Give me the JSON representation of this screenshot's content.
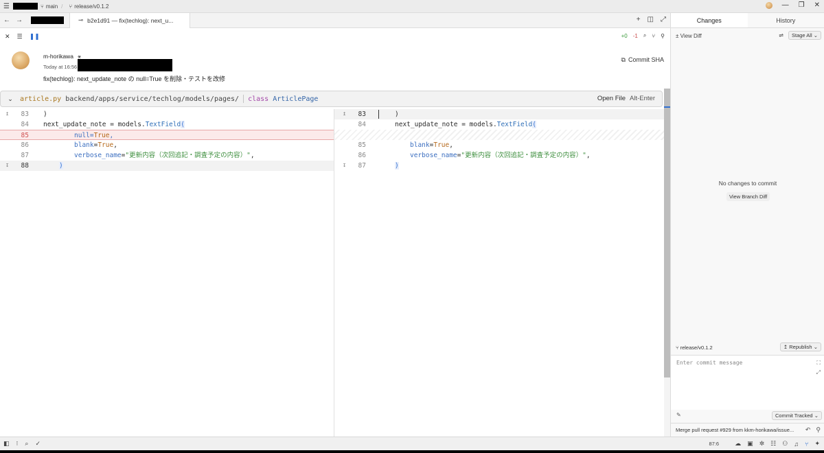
{
  "titlebar": {
    "menu_icon": "hamburger-icon",
    "branch_main": "main",
    "branch_release": "release/v0.1.2",
    "window_controls": [
      "minimize",
      "maximize",
      "close"
    ]
  },
  "tabs": {
    "active_title": "b2e1d91 — fix(techlog): next_u..."
  },
  "toolbar": {
    "additions": "+0",
    "deletions": "-1"
  },
  "commit": {
    "author": "m-horikawa",
    "time_prefix": "Today at 16:56",
    "message": "fix(techlog): next_update_note の null=True を削除・テストを改修",
    "sha_button": "Commit SHA"
  },
  "file_header": {
    "file_name": "article.py",
    "path": "backend/apps/service/techlog/models/pages/",
    "keyword": "class",
    "class_name": "ArticlePage",
    "open_file": "Open File",
    "shortcut": "Alt-Enter"
  },
  "diff": {
    "left": [
      {
        "ln": "83",
        "code": ")"
      },
      {
        "ln": "84",
        "code": "next_update_note = models.TextField("
      },
      {
        "ln": "85",
        "code": "null=True,"
      },
      {
        "ln": "86",
        "code": "blank=True,"
      },
      {
        "ln": "87",
        "code": "verbose_name=\"更新内容（次回追記・調査予定の内容）\","
      },
      {
        "ln": "88",
        "code": ")"
      }
    ],
    "right": [
      {
        "ln": "83",
        "code": ")"
      },
      {
        "ln": "84",
        "code": "next_update_note = models.TextField("
      },
      {
        "ln": "85",
        "code": "blank=True,"
      },
      {
        "ln": "86",
        "code": "verbose_name=\"更新内容（次回追記・調査予定の内容）\","
      },
      {
        "ln": "87",
        "code": ")"
      }
    ]
  },
  "right_panel": {
    "tab_changes": "Changes",
    "tab_history": "History",
    "view_diff": "View Diff",
    "stage_all": "Stage All",
    "empty_text": "No changes to commit",
    "view_branch_diff": "View Branch Diff",
    "branch": "release/v0.1.2",
    "republish": "Republish",
    "commit_placeholder": "Enter commit message",
    "commit_tracked": "Commit Tracked",
    "last_commit": "Merge pull request #929 from kkm-horikawa/issue..."
  },
  "statusbar": {
    "cursor_pos": "87:6"
  },
  "colors": {
    "accent": "#2f6fd1",
    "removed_line_bg": "#fbeaea",
    "removed_border": "#e7a8a8",
    "string_green": "#3f8f3f",
    "keyword_orange": "#b66a1c",
    "file_name_color": "#a8761e"
  }
}
